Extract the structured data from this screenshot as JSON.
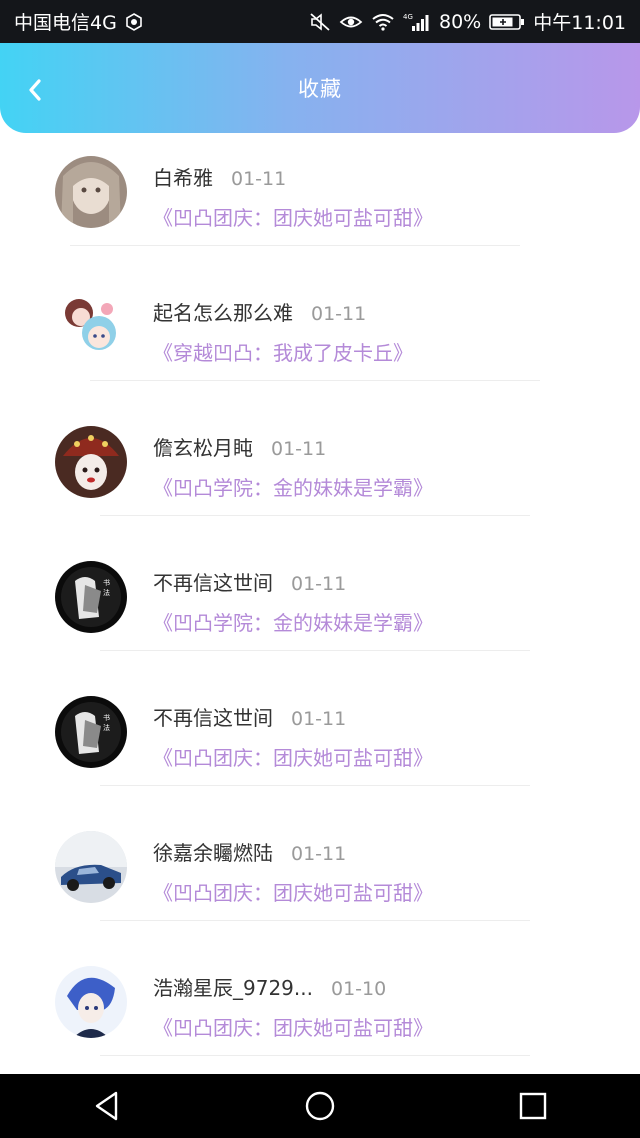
{
  "status_bar": {
    "carrier": "中国电信4G",
    "battery": "80%",
    "time": "中午11:01"
  },
  "header": {
    "title": "收藏",
    "back_icon": "chevron-left-icon",
    "gradient_colors": [
      "#43d3f4",
      "#b897ea"
    ]
  },
  "favorites": [
    {
      "user": "白希雅",
      "date": "01-11",
      "title": "《凹凸团庆：团庆她可盐可甜》",
      "avatar": "avatar-girl-beige"
    },
    {
      "user": "起名怎么那么难",
      "date": "01-11",
      "title": "《穿越凹凸：我成了皮卡丘》",
      "avatar": "avatar-two-kids"
    },
    {
      "user": "儋玄松月盹",
      "date": "01-11",
      "title": "《凹凸学院：金的妹妹是学霸》",
      "avatar": "avatar-clown-hat"
    },
    {
      "user": "不再信这世间",
      "date": "01-11",
      "title": "《凹凸学院：金的妹妹是学霸》",
      "avatar": "avatar-bw-calligraphy"
    },
    {
      "user": "不再信这世间",
      "date": "01-11",
      "title": "《凹凸团庆：团庆她可盐可甜》",
      "avatar": "avatar-bw-calligraphy"
    },
    {
      "user": "徐嘉余矚燃陆",
      "date": "01-11",
      "title": "《凹凸团庆：团庆她可盐可甜》",
      "avatar": "avatar-blue-car"
    },
    {
      "user": "浩瀚星辰_9729...",
      "date": "01-10",
      "title": "《凹凸团庆：团庆她可盐可甜》",
      "avatar": "avatar-blue-hair-boy"
    }
  ],
  "colors": {
    "title_accent": "#b48ad8",
    "name_text": "#333333",
    "date_text": "#9a9a9a"
  },
  "nav": {
    "back": "triangle-back-icon",
    "home": "circle-home-icon",
    "recents": "square-recents-icon"
  }
}
